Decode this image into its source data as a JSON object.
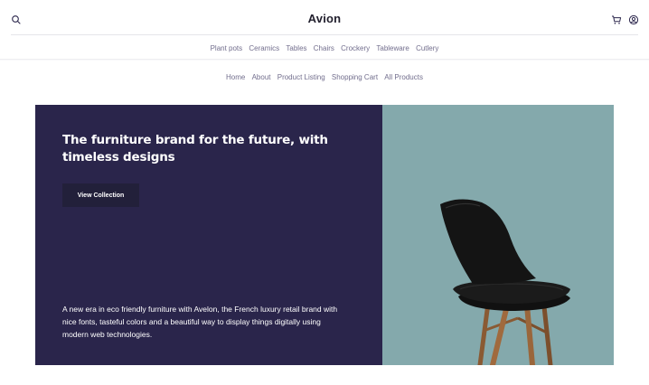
{
  "header": {
    "brand": "Avion",
    "icons": {
      "search": "search-icon",
      "cart": "cart-icon",
      "account": "user-icon"
    }
  },
  "categories": [
    "Plant pots",
    "Ceramics",
    "Tables",
    "Chairs",
    "Crockery",
    "Tableware",
    "Cutlery"
  ],
  "pages": [
    "Home",
    "About",
    "Product Listing",
    "Shopping Cart",
    "All Products"
  ],
  "hero": {
    "title": "The furniture brand for the future, with timeless designs",
    "button_label": "View Collection",
    "description": "A new era in eco friendly furniture with Avelon, the French luxury retail brand with nice fonts, tasteful colors and a beautiful way to display things digitally using modern web technologies.",
    "image": "chair-image"
  },
  "colors": {
    "hero_dark": "#2A254B",
    "hero_image_bg": "#84A9AC",
    "button_dark": "#22203A",
    "nav_text": "#726E8D"
  }
}
